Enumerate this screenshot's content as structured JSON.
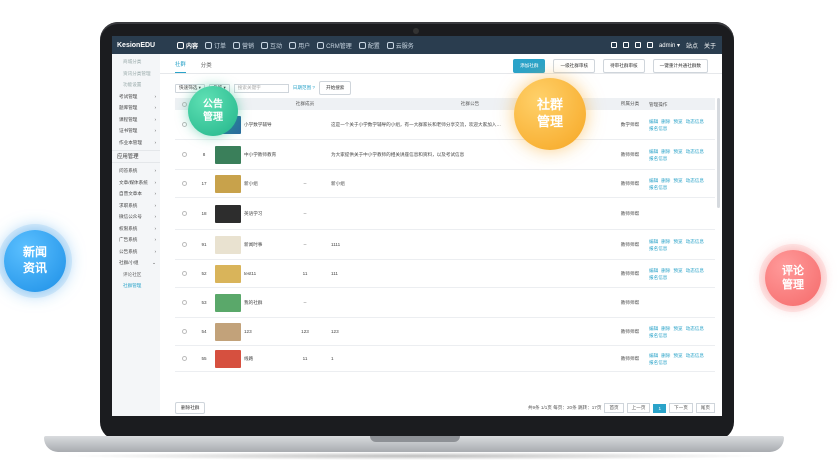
{
  "app": {
    "logo": "KesionEDU"
  },
  "topnav": [
    {
      "label": "内容",
      "icon": "content-icon",
      "active": true
    },
    {
      "label": "订单",
      "icon": "order-icon",
      "active": false
    },
    {
      "label": "营销",
      "icon": "tag-icon",
      "active": false
    },
    {
      "label": "互动",
      "icon": "chat-icon",
      "active": false
    },
    {
      "label": "用户",
      "icon": "user-icon",
      "active": false
    },
    {
      "label": "CRM管理",
      "icon": "crm-icon",
      "active": false
    },
    {
      "label": "配置",
      "icon": "gear-icon",
      "active": false
    },
    {
      "label": "云服务",
      "icon": "cloud-icon",
      "active": false
    }
  ],
  "topright": {
    "user": "admin ▾",
    "link1": "站点",
    "link2": "关于"
  },
  "sidebar": {
    "top_items": [
      "商城分类",
      "资讯分类管理",
      "功能设置",
      "考试管理",
      "题库管理",
      "课程管理",
      "证书管理",
      "作业本管理"
    ],
    "group": "应用管理",
    "items": [
      "问答系统",
      "文章/媒体系统",
      "自营文章本",
      "求职系统",
      "微信公众号",
      "权限系统",
      "广告系统",
      "公告系统",
      "社群/小组",
      "评论社区",
      "社群管理"
    ]
  },
  "tabs": {
    "t1": "社群",
    "t2": "分类"
  },
  "buttons": {
    "add": "添加社群",
    "b2": "一级社群审核",
    "b3": "待审社群审核",
    "b4": "一键重计共通社群数"
  },
  "filter": {
    "f1": "快速筛选",
    "f2": "名称",
    "placeholder": "搜索关键字",
    "date": "日期范围 ?",
    "search": "开始搜索"
  },
  "columns": {
    "id": "ID",
    "name": "社群名称",
    "count": "社群成员",
    "notice": "社群公告",
    "creator": "所属分类",
    "ops": "管理操作"
  },
  "rows": [
    {
      "id": "",
      "name": "小学数学辅导",
      "count": "",
      "notice": "这是一个关于小学数学辅导的小组，有一大群家长和老师分享交流，欢迎大家加入…",
      "creator": "数学师帮",
      "thumb": "#2b6c9e"
    },
    {
      "id": "8",
      "name": "中小学教师教育",
      "count": "",
      "notice": "为大家提供关于中小学教师的相关讲座信息和资料，以及考试信息",
      "creator": "教师师帮",
      "thumb": "#3a7f5a"
    },
    {
      "id": "17",
      "name": "新小组",
      "count": "--",
      "notice": "新小组",
      "creator": "教师师帮",
      "thumb": "#c8a24b"
    },
    {
      "id": "18",
      "name": "英语学习",
      "count": "--",
      "notice": "",
      "creator": "教师师帮",
      "thumb": "#2d2d2d"
    },
    {
      "id": "91",
      "name": "新闻时事",
      "count": "--",
      "notice": "1111",
      "creator": "教师师帮",
      "thumb": "#e9e2d0"
    },
    {
      "id": "52",
      "name": "test11",
      "count": "11",
      "notice": "111",
      "creator": "教师师帮",
      "thumb": "#d9b45a"
    },
    {
      "id": "53",
      "name": "我的社群",
      "count": "--",
      "notice": "",
      "creator": "教师师帮",
      "thumb": "#5aa86a"
    },
    {
      "id": "54",
      "name": "123",
      "count": "123",
      "notice": "123",
      "creator": "教师师帮",
      "thumb": "#c2a27a"
    },
    {
      "id": "55",
      "name": "线路",
      "count": "11",
      "notice": "1",
      "creator": "教师师帮",
      "thumb": "#d6503f"
    }
  ],
  "ops": [
    "编辑",
    "删除",
    "预览",
    "动态信息",
    "报名信息"
  ],
  "footer": {
    "delete": "删除社群",
    "info": "共9条 1/1页 每页：20条 跳转：17页",
    "first": "首页",
    "prev": "上一页",
    "cur": "1",
    "next": "下一页",
    "last": "尾页"
  },
  "bubbles": {
    "notice": "公告\n管理",
    "community": "社群\n管理",
    "news": "新闻\n资讯",
    "comment": "评论\n管理"
  }
}
